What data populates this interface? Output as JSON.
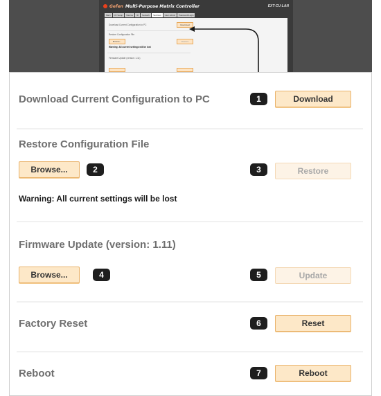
{
  "thumbnail": {
    "brand_logo": "Gefen",
    "brand_title": "Multi-Purpose Matrix Controller",
    "model": "EXT-CU-LAN",
    "nav_tabs": [
      "Main",
      "I/O Setup",
      "Macros",
      "IR",
      "Network",
      "Services",
      "User Admin",
      "Password/Login"
    ],
    "active_tab": "Services",
    "rows": [
      "Download Current Configuration to PC",
      "Restore Configuration File",
      "Warning: All current settings will be lost",
      "Firmware Update (version: 1.11)"
    ],
    "buttons": [
      "Download",
      "Browse...",
      "Restore"
    ]
  },
  "sections": {
    "download": {
      "title": "Download Current Configuration to PC",
      "badge": "1",
      "button": "Download"
    },
    "restore": {
      "title": "Restore Configuration File",
      "browse_button": "Browse...",
      "browse_badge": "2",
      "restore_badge": "3",
      "restore_button": "Restore",
      "warning": "Warning: All current settings will be lost"
    },
    "firmware": {
      "title": "Firmware Update (version: 1.11)",
      "browse_button": "Browse...",
      "browse_badge": "4",
      "update_badge": "5",
      "update_button": "Update"
    },
    "factory_reset": {
      "title": "Factory Reset",
      "badge": "6",
      "button": "Reset"
    },
    "reboot": {
      "title": "Reboot",
      "badge": "7",
      "button": "Reboot"
    }
  },
  "colors": {
    "button_fill": "#fde8c8",
    "button_border": "#e9b26a",
    "badge_fill": "#1e1e1e",
    "frame_dark": "#4d4d4d"
  }
}
